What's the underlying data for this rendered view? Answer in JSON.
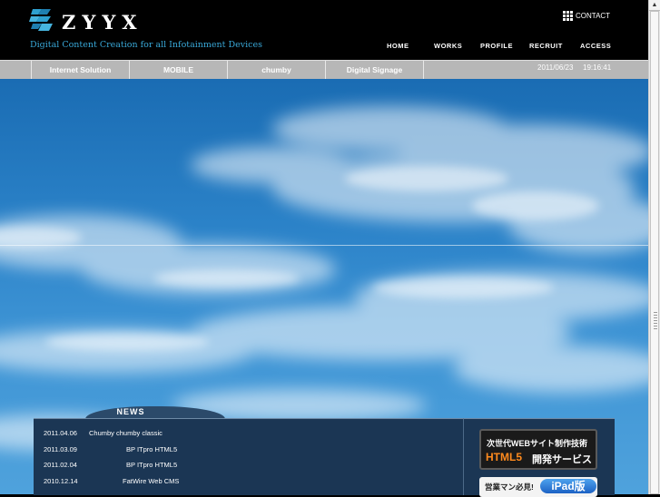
{
  "brand": {
    "logo_text": "ZYYX",
    "tagline": "Digital Content Creation for all Infotainment Devices"
  },
  "header": {
    "contact_label": "CONTACT"
  },
  "nav": {
    "items": [
      "HOME",
      "WORKS",
      "PROFILE",
      "RECRUIT",
      "ACCESS"
    ]
  },
  "subnav": {
    "items": [
      "Internet Solution",
      "MOBILE",
      "chumby",
      "Digital Signage"
    ],
    "date": "2011/06/23",
    "time": "19:16:41"
  },
  "news": {
    "title": "NEWS",
    "items": [
      {
        "date": "2011.04.06",
        "text": "Chumby   chumby classic"
      },
      {
        "date": "2011.03.09",
        "text": "BP   ITpro   HTML5"
      },
      {
        "date": "2011.02.04",
        "text": "BP   ITpro   HTML5"
      },
      {
        "date": "2010.12.14",
        "text": "FatWire Web CMS"
      }
    ]
  },
  "banners": {
    "html5": {
      "line1": "次世代WEBサイト制作技術",
      "line2": "HTML5",
      "line3": "開発サービス"
    },
    "ipad": {
      "line1": "営業マン必見!",
      "pill": "iPad版"
    }
  },
  "colors": {
    "accent": "#39a8d8",
    "subnav_bg": "#b7b7b7",
    "news_bg": "#1b3654",
    "sky": "#2b82c8"
  }
}
